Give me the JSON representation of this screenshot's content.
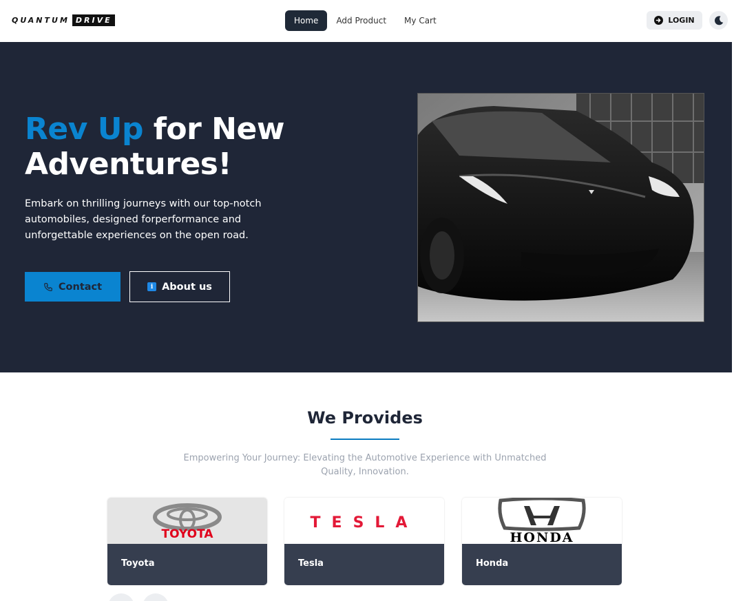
{
  "navbar": {
    "logo_part1": "QUANTUM",
    "logo_part2": "DRIVE",
    "links": [
      {
        "label": "Home",
        "active": true
      },
      {
        "label": "Add Product",
        "active": false
      },
      {
        "label": "My Cart",
        "active": false
      }
    ],
    "login_label": "LOGIN",
    "login_icon": "login-arrow-icon",
    "theme_icon": "moon-icon"
  },
  "hero": {
    "title_accent": "Rev Up",
    "title_rest_line1": " for New",
    "title_line2": "Adventures!",
    "description": "Embark on thrilling journeys with our top-notch automobiles, designed forperformance and unforgettable experiences on the open road.",
    "contact_label": "Contact",
    "contact_icon": "phone-icon",
    "about_label": "About us",
    "about_icon": "info-icon",
    "image_subject": "black-tesla-car-photo"
  },
  "provides": {
    "title": "We Provides",
    "subtitle": "Empowering Your Journey: Elevating the Automotive Experience with Unmatched Quality, Innovation."
  },
  "brands": [
    {
      "name": "Toyota",
      "logo_text": "TOYOTA"
    },
    {
      "name": "Tesla",
      "logo_text": "TESLA"
    },
    {
      "name": "Honda",
      "logo_text": "HONDA"
    }
  ],
  "colors": {
    "accent": "#0a84d0",
    "hero_bg": "#1f2637",
    "card_footer": "#363e4f",
    "nav_active": "#1f2937"
  }
}
